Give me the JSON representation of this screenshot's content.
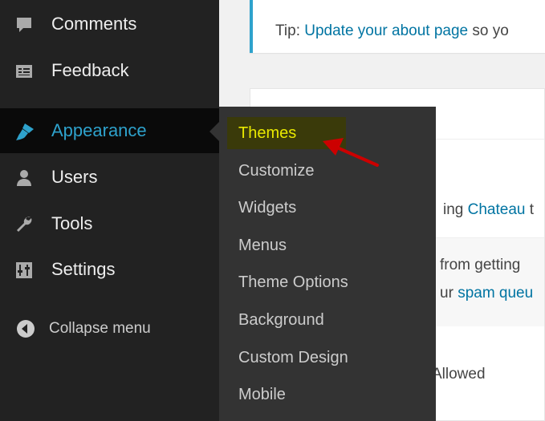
{
  "tip": {
    "prefix": "Tip: ",
    "link": "Update your about page",
    "suffix": " so yo"
  },
  "panel": {
    "line1_prefix": "ing ",
    "line1_link": "Chateau",
    "line1_suffix": " t",
    "line2": "from getting",
    "line3_prefix": "ur ",
    "line3_link": "spam queu",
    "line4_link": "Allowed"
  },
  "sidebar": {
    "items": [
      {
        "label": "Comments",
        "icon": "comment-bubble-icon"
      },
      {
        "label": "Feedback",
        "icon": "feedback-card-icon"
      },
      {
        "label": "Appearance",
        "icon": "paintbrush-icon",
        "active": true
      },
      {
        "label": "Users",
        "icon": "user-icon"
      },
      {
        "label": "Tools",
        "icon": "wrench-icon"
      },
      {
        "label": "Settings",
        "icon": "sliders-icon"
      }
    ],
    "collapse_label": "Collapse menu"
  },
  "submenu": {
    "items": [
      "Themes",
      "Customize",
      "Widgets",
      "Menus",
      "Theme Options",
      "Background",
      "Custom Design",
      "Mobile"
    ],
    "current": "Themes"
  },
  "colors": {
    "sidebar_bg": "#222222",
    "flyout_bg": "#333333",
    "accent_blue": "#2ea2cc",
    "link_blue": "#0074a2",
    "current_highlight": "#e8e800",
    "annotation_arrow": "#cc0000"
  }
}
